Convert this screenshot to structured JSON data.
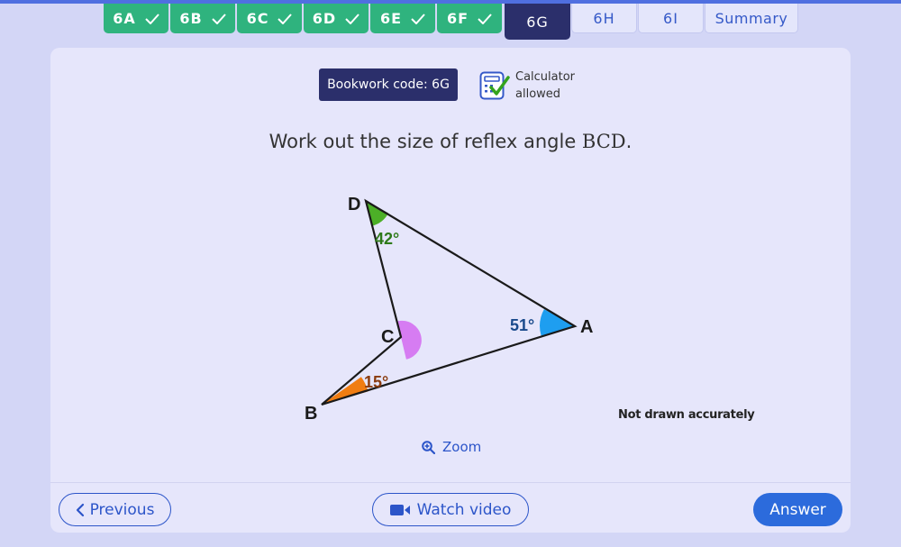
{
  "tabs": [
    {
      "label": "6A",
      "state": "done"
    },
    {
      "label": "6B",
      "state": "done"
    },
    {
      "label": "6C",
      "state": "done"
    },
    {
      "label": "6D",
      "state": "done"
    },
    {
      "label": "6E",
      "state": "done"
    },
    {
      "label": "6F",
      "state": "done"
    },
    {
      "label": "6G",
      "state": "active"
    },
    {
      "label": "6H",
      "state": "todo"
    },
    {
      "label": "6I",
      "state": "todo"
    },
    {
      "label": "Summary",
      "state": "todo"
    }
  ],
  "header": {
    "bookwork_code": "Bookwork code: 6G",
    "calculator_line1": "Calculator",
    "calculator_line2": "allowed"
  },
  "question": {
    "prefix": "Work out the size of reflex angle ",
    "math": "BCD",
    "suffix": "."
  },
  "diagram": {
    "points": {
      "D": "D",
      "A": "A",
      "C": "C",
      "B": "B"
    },
    "angles": {
      "D": "42°",
      "A": "51°",
      "B": "15°"
    },
    "colors": {
      "D": "#4caf27",
      "A": "#1e9ef0",
      "B": "#f07d12",
      "C": "#d67cf2",
      "label_D": "#2e7a1a",
      "label_A": "#1a4a8c",
      "label_B": "#8a3c10"
    }
  },
  "note": "Not drawn accurately",
  "zoom_label": "Zoom",
  "footer": {
    "previous": "Previous",
    "watch_video": "Watch video",
    "answer": "Answer"
  },
  "colors": {
    "tab_done": "#2fb37e",
    "tab_active": "#2b2f6b",
    "primary": "#2c55c9",
    "answer_button": "#2c6bdc"
  }
}
